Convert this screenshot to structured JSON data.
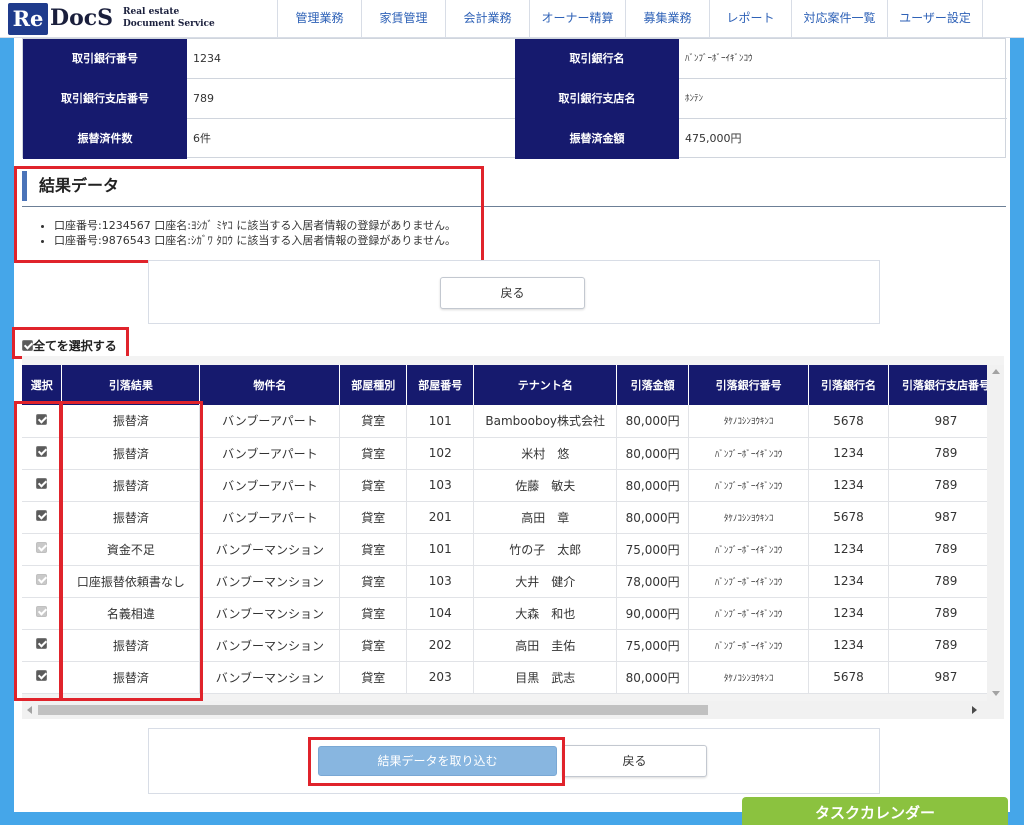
{
  "header": {
    "logo": {
      "mark": "Re",
      "name": "DocS",
      "tagline1": "Real estate",
      "tagline2": "Document Service"
    },
    "nav": [
      {
        "label": "管理業務",
        "w": 84
      },
      {
        "label": "家賃管理",
        "w": 84
      },
      {
        "label": "会計業務",
        "w": 84
      },
      {
        "label": "オーナー精算",
        "w": 96
      },
      {
        "label": "募集業務",
        "w": 84
      },
      {
        "label": "レポート",
        "w": 82
      },
      {
        "label": "対応案件一覧",
        "w": 96
      },
      {
        "label": "ユーザー設定",
        "w": 96
      }
    ]
  },
  "info": {
    "rows": [
      {
        "l1": "取引銀行番号",
        "v1": "1234",
        "l2": "取引銀行名",
        "v2": "ﾊﾞﾝﾌﾞｰﾎﾞｰｲｷﾞﾝｺｳ"
      },
      {
        "l1": "取引銀行支店番号",
        "v1": "789",
        "l2": "取引銀行支店名",
        "v2": "ﾎﾝﾃﾝ"
      },
      {
        "l1": "振替済件数",
        "v1": "6件",
        "l2": "振替済金額",
        "v2": "475,000円"
      }
    ]
  },
  "result": {
    "title": "結果データ",
    "messages": [
      "口座番号:1234567 口座名:ﾖｼｶﾞ ﾐﾔｺ に該当する入居者情報の登録がありません。",
      "口座番号:9876543 口座名:ｼｶﾞﾜ ﾀﾛｳ に該当する入居者情報の登録がありません。"
    ]
  },
  "back_label": "戻る",
  "select_all_label": "全てを選択する",
  "table": {
    "columns": [
      "選択",
      "引落結果",
      "物件名",
      "部屋種別",
      "部屋番号",
      "テナント名",
      "引落金額",
      "引落銀行番号",
      "引落銀行名",
      "引落銀行支店番号"
    ],
    "rows": [
      {
        "checked": true,
        "result": "振替済",
        "property": "バンブーアパート",
        "type": "貸室",
        "room": "101",
        "tenant": "Bambooboy株式会社",
        "amount": "80,000円",
        "bank_no": "ﾀｹﾉｺｼﾝﾖｳｷﾝｺ",
        "bank_name": "5678",
        "branch_no": "987"
      },
      {
        "checked": true,
        "result": "振替済",
        "property": "バンブーアパート",
        "type": "貸室",
        "room": "102",
        "tenant": "米村　悠",
        "amount": "80,000円",
        "bank_no": "ﾊﾞﾝﾌﾞｰﾎﾞｰｲｷﾞﾝｺｳ",
        "bank_name": "1234",
        "branch_no": "789"
      },
      {
        "checked": true,
        "result": "振替済",
        "property": "バンブーアパート",
        "type": "貸室",
        "room": "103",
        "tenant": "佐藤　敏夫",
        "amount": "80,000円",
        "bank_no": "ﾊﾞﾝﾌﾞｰﾎﾞｰｲｷﾞﾝｺｳ",
        "bank_name": "1234",
        "branch_no": "789"
      },
      {
        "checked": true,
        "result": "振替済",
        "property": "バンブーアパート",
        "type": "貸室",
        "room": "201",
        "tenant": "高田　章",
        "amount": "80,000円",
        "bank_no": "ﾀｹﾉｺｼﾝﾖｳｷﾝｺ",
        "bank_name": "5678",
        "branch_no": "987"
      },
      {
        "checked": false,
        "result": "資金不足",
        "property": "バンブーマンション",
        "type": "貸室",
        "room": "101",
        "tenant": "竹の子　太郎",
        "amount": "75,000円",
        "bank_no": "ﾊﾞﾝﾌﾞｰﾎﾞｰｲｷﾞﾝｺｳ",
        "bank_name": "1234",
        "branch_no": "789"
      },
      {
        "checked": false,
        "result": "口座振替依頼書なし",
        "property": "バンブーマンション",
        "type": "貸室",
        "room": "103",
        "tenant": "大井　健介",
        "amount": "78,000円",
        "bank_no": "ﾊﾞﾝﾌﾞｰﾎﾞｰｲｷﾞﾝｺｳ",
        "bank_name": "1234",
        "branch_no": "789"
      },
      {
        "checked": false,
        "result": "名義相違",
        "property": "バンブーマンション",
        "type": "貸室",
        "room": "104",
        "tenant": "大森　和也",
        "amount": "90,000円",
        "bank_no": "ﾊﾞﾝﾌﾞｰﾎﾞｰｲｷﾞﾝｺｳ",
        "bank_name": "1234",
        "branch_no": "789"
      },
      {
        "checked": true,
        "result": "振替済",
        "property": "バンブーマンション",
        "type": "貸室",
        "room": "202",
        "tenant": "高田　圭佑",
        "amount": "75,000円",
        "bank_no": "ﾊﾞﾝﾌﾞｰﾎﾞｰｲｷﾞﾝｺｳ",
        "bank_name": "1234",
        "branch_no": "789"
      },
      {
        "checked": true,
        "result": "振替済",
        "property": "バンブーマンション",
        "type": "貸室",
        "room": "203",
        "tenant": "目黒　武志",
        "amount": "80,000円",
        "bank_no": "ﾀｹﾉｺｼﾝﾖｳｷﾝｺ",
        "bank_name": "5678",
        "branch_no": "987"
      }
    ]
  },
  "import_label": "結果データを取り込む",
  "task_calendar_label": "タスクカレンダー",
  "colors": {
    "nav_text": "#2f62b7",
    "header_cell": "#161a6e",
    "frame": "#45a6e9",
    "highlight": "#e0232b",
    "primary_button": "#88b6e0",
    "calendar": "#8bc23f"
  }
}
